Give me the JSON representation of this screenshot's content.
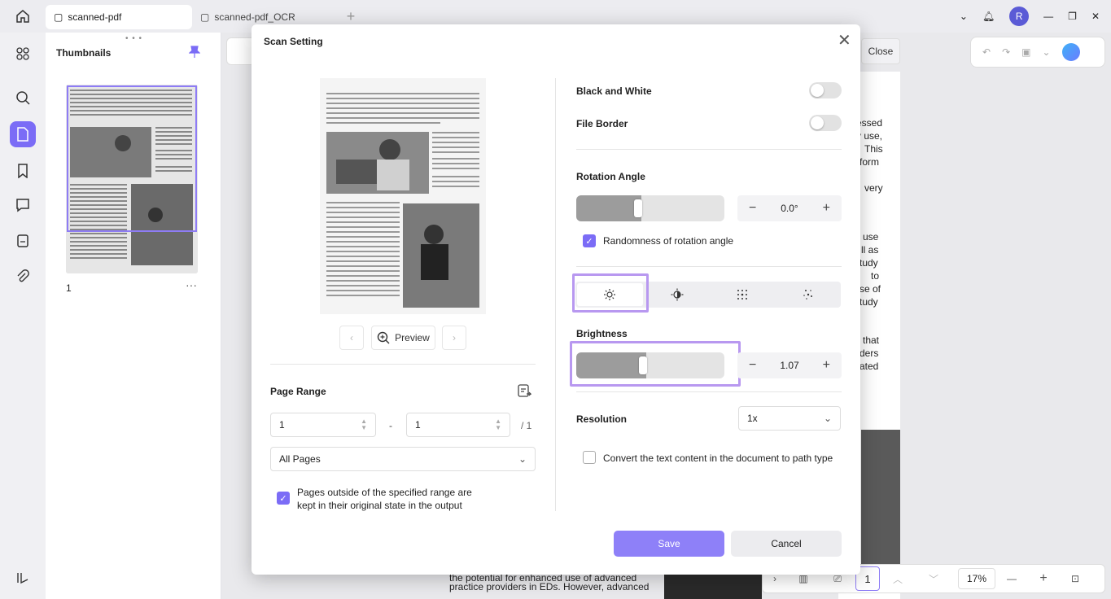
{
  "tabs": [
    {
      "label": "scanned-pdf",
      "active": true
    },
    {
      "label": "scanned-pdf_OCR",
      "active": false
    }
  ],
  "user": {
    "initial": "R"
  },
  "thumbnails": {
    "title": "Thumbnails",
    "page_number": "1"
  },
  "toolbar": {
    "close_label": "Close"
  },
  "document_text": {
    "right_column": [
      "essed",
      "y use,",
      "This",
      "rform",
      "very",
      "use",
      "ll as",
      "tudy",
      "to",
      "se of",
      "tudy",
      "that",
      "ders",
      "ated"
    ],
    "bottom_lines": [
      "the potential for enhanced use of advanced",
      "practice providers in EDs. However, advanced"
    ]
  },
  "bottom_bar": {
    "page": "1",
    "zoom": "17%"
  },
  "modal": {
    "title": "Scan Setting",
    "preview_label": "Preview",
    "page_range": {
      "label": "Page Range",
      "from": "1",
      "to": "1",
      "separator": "-",
      "total": "/ 1",
      "pages_option": "All Pages",
      "keep_outside_label": "Pages outside of the specified range are kept in their original state in the output",
      "keep_outside_checked": true
    },
    "black_and_white": {
      "label": "Black and White",
      "on": false
    },
    "file_border": {
      "label": "File Border",
      "on": false
    },
    "rotation": {
      "label": "Rotation Angle",
      "value": "0.0°",
      "slider_fraction": 0.44,
      "randomness_label": "Randomness of rotation angle",
      "randomness_checked": true
    },
    "modes": [
      {
        "icon": "sun-icon",
        "active": true
      },
      {
        "icon": "contrast-icon",
        "active": false
      },
      {
        "icon": "dots-grid-icon",
        "active": false
      },
      {
        "icon": "dots-sparse-icon",
        "active": false
      }
    ],
    "brightness": {
      "label": "Brightness",
      "value": "1.07",
      "slider_fraction": 0.47
    },
    "resolution": {
      "label": "Resolution",
      "value": "1x"
    },
    "convert_path": {
      "label": "Convert the text content in the document to path type",
      "checked": false
    },
    "save_label": "Save",
    "cancel_label": "Cancel"
  }
}
